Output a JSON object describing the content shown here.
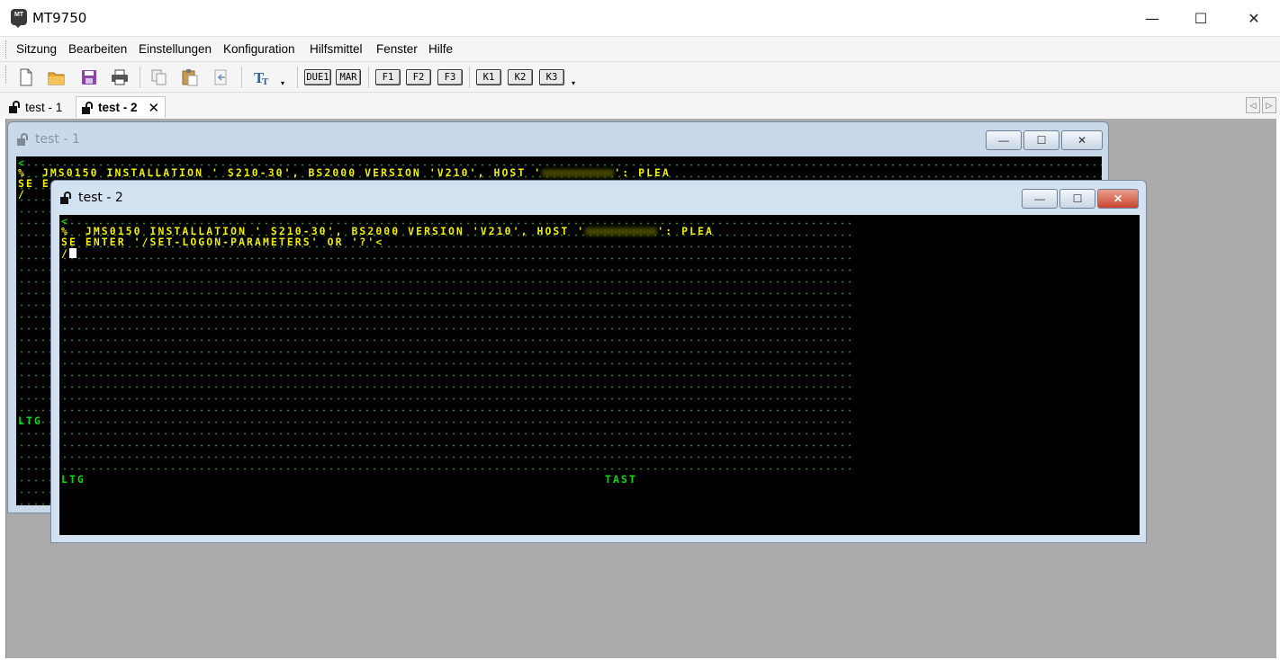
{
  "app": {
    "title": "MT9750",
    "icon": "terminal-app-icon"
  },
  "window_controls": {
    "minimize": "—",
    "maximize": "☐",
    "close": "✕"
  },
  "menu": [
    "Sitzung",
    "Bearbeiten",
    "Einstellungen",
    "Konfiguration",
    "Hilfsmittel",
    "Fenster",
    "Hilfe"
  ],
  "toolbar": {
    "icons": [
      "new-file-icon",
      "open-folder-icon",
      "save-icon",
      "print-icon",
      "copy-icon",
      "paste-icon",
      "paste-special-icon",
      "font-icon"
    ],
    "keys": [
      "DUE1",
      "MAR",
      "F1",
      "F2",
      "F3",
      "K1",
      "K2",
      "K3"
    ],
    "dropdown": "▾"
  },
  "tabs": [
    {
      "label": "test - 1",
      "active": false
    },
    {
      "label": "test - 2",
      "active": true,
      "close": "✕"
    }
  ],
  "tab_scroll": {
    "left": "◁",
    "right": "▷"
  },
  "windows": {
    "test1": {
      "title": "test - 1",
      "lines": {
        "l0": "<",
        "l1a": "%  JMS0150 INSTALLATION ' S210-30', BS2000 VERSION 'V210', HOST '",
        "l1b": "': PLEA",
        "l2": "SE E",
        "l3": "/",
        "status": "LTG"
      }
    },
    "test2": {
      "title": "test - 2",
      "lines": {
        "l0": "<",
        "l1a": "%  JMS0150 INSTALLATION ' S210-30', BS2000 VERSION 'V210', HOST '",
        "l1b": "': PLEA",
        "l2": "SE ENTER '/SET-LOGON-PARAMETERS' OR '?'<",
        "l3": "/",
        "status_left": "LTG",
        "status_mid": "TAST"
      }
    }
  },
  "colors": {
    "terminal_bg": "#000000",
    "terminal_text": "#f0f000",
    "status_text": "#00e000",
    "mdi_bg": "#ababab"
  }
}
